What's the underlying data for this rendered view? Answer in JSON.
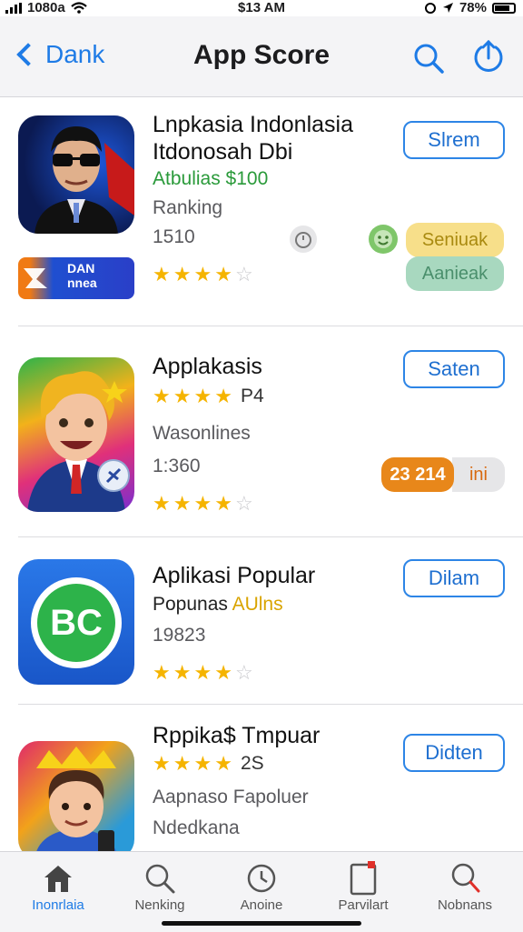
{
  "status_bar": {
    "carrier": "1080a",
    "time": "$13 AM",
    "battery": "78%"
  },
  "nav": {
    "back_label": "Dank",
    "title": "App Score"
  },
  "apps": [
    {
      "name_line1": "Lnpkasia Indonlasia",
      "name_line2": "Itdonosah Dbi",
      "subtitle": "Atbulias $100",
      "label": "Ranking",
      "number": "1510",
      "stars": 4,
      "button": "Slrem",
      "banner_text_1": "DAN",
      "banner_text_2": "nnea",
      "pill_1": "Seniuak",
      "pill_2": "Aanieak"
    },
    {
      "name_line1": "Applakasis",
      "rating_text": "P4",
      "label": "Wasonlines",
      "number": "1:360",
      "stars": 4,
      "button": "Saten",
      "pill_count": "23 214",
      "pill_extra": "ini"
    },
    {
      "name_line1": "Aplikasi Popular",
      "subtitle_a": "Popunas",
      "subtitle_b": "AUlns",
      "number": "19823",
      "stars": 4,
      "button": "Dilam",
      "icon_text": "BC"
    },
    {
      "name_line1": "Rppika$ Tmpuar",
      "rating_text": "2S",
      "label": "Aapnaso Fapoluer",
      "number": "Ndedkana",
      "button": "Didten"
    }
  ],
  "tabs": [
    {
      "label": "Inonrlaia",
      "icon": "home-icon",
      "active": true
    },
    {
      "label": "Nenking",
      "icon": "search-icon"
    },
    {
      "label": "Anoine",
      "icon": "clock-icon"
    },
    {
      "label": "Parvilart",
      "icon": "document-icon"
    },
    {
      "label": "Nobnans",
      "icon": "magnifier-icon"
    }
  ],
  "colors": {
    "accent": "#1e7be6",
    "star": "#f5b400",
    "green": "#2a9a3a",
    "orange_pill": "#e8871a"
  }
}
